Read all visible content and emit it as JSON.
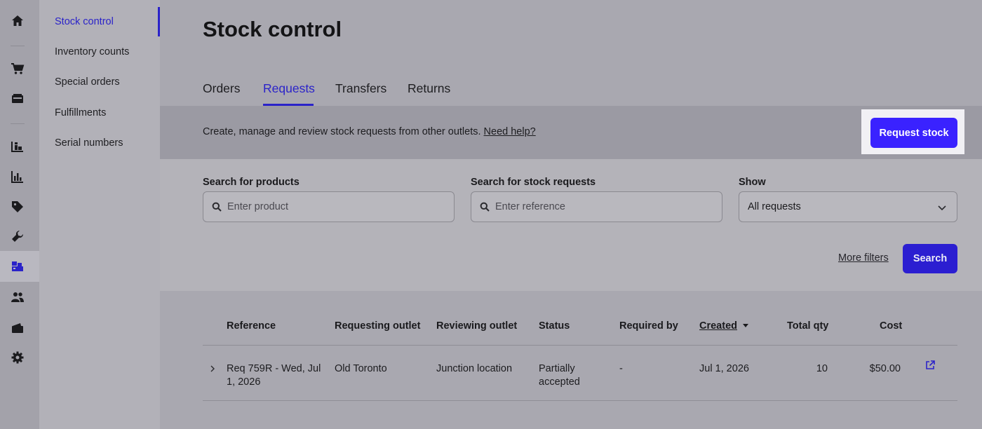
{
  "rail": {
    "icons": [
      "home-icon",
      "cart-icon",
      "register-icon",
      "inventory-icon",
      "reports-icon",
      "tag-icon",
      "wrench-icon",
      "stock-control-icon",
      "customers-icon",
      "wallet-icon",
      "gear-icon"
    ]
  },
  "subnav": {
    "items": [
      {
        "label": "Stock control"
      },
      {
        "label": "Inventory counts"
      },
      {
        "label": "Special orders"
      },
      {
        "label": "Fulfillments"
      },
      {
        "label": "Serial numbers"
      }
    ]
  },
  "page": {
    "title": "Stock control",
    "tabs": [
      {
        "label": "Orders"
      },
      {
        "label": "Requests"
      },
      {
        "label": "Transfers"
      },
      {
        "label": "Returns"
      }
    ],
    "description": "Create, manage and review stock requests from other outlets.",
    "help_link": "Need help?",
    "request_stock_label": "Request stock"
  },
  "filters": {
    "products_label": "Search for products",
    "products_placeholder": "Enter product",
    "requests_label": "Search for stock requests",
    "requests_placeholder": "Enter reference",
    "show_label": "Show",
    "show_value": "All requests",
    "more_filters": "More filters",
    "search_label": "Search"
  },
  "table": {
    "columns": [
      "Reference",
      "Requesting outlet",
      "Reviewing outlet",
      "Status",
      "Required by",
      "Created",
      "Total qty",
      "Cost"
    ],
    "rows": [
      {
        "reference": "Req 759R - Wed, Jul 1, 2026",
        "requesting_outlet": "Old Toronto",
        "reviewing_outlet": "Junction location",
        "status": "Partially accepted",
        "required_by": "-",
        "created": "Jul 1, 2026",
        "total_qty": "10",
        "cost": "$50.00"
      }
    ]
  },
  "colors": {
    "accent": "#3a22ff",
    "active_nav": "#2b23c9"
  }
}
